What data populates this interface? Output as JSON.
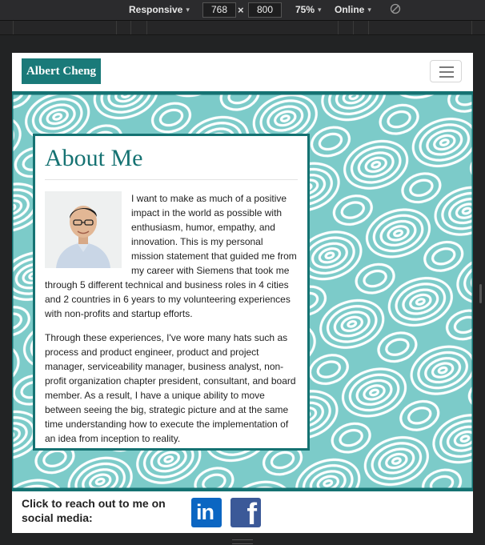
{
  "devtools": {
    "device_mode": "Responsive",
    "width_value": "768",
    "height_value": "800",
    "times_sign": "×",
    "zoom": "75%",
    "network": "Online",
    "caret": "▾"
  },
  "navbar": {
    "brand": "Albert Cheng"
  },
  "about": {
    "heading": "About Me",
    "paragraph_1": "I want to make as much of a positive impact in the world as possible with enthusiasm, humor, empathy, and innovation. This is my personal mission statement that guided me from my career with Siemens that took me through 5 different technical and business roles in 4 cities and 2 countries in 6 years to my volunteering experiences with non-profits and startup efforts.",
    "paragraph_2": "Through these experiences, I've wore many hats such as process and product engineer, product and project manager, serviceability manager, business analyst, non-profit organization chapter president, consultant, and board member. As a result, I have a unique ability to move between seeing the big, strategic picture and at the same time understanding how to execute the implementation of an idea from inception to reality."
  },
  "footer": {
    "social_text": "Click to reach out to me on social media:",
    "linkedin_glyph": "in",
    "facebook_glyph": "f"
  },
  "icons": [
    "hamburger-menu-icon",
    "rotate-icon",
    "linkedin-icon",
    "facebook-icon"
  ],
  "colors": {
    "accent": "#157272",
    "brand_bg": "#1a7a79",
    "pattern_bg": "#7ccbc9",
    "linkedin": "#0b66c2",
    "facebook": "#3b5998"
  }
}
